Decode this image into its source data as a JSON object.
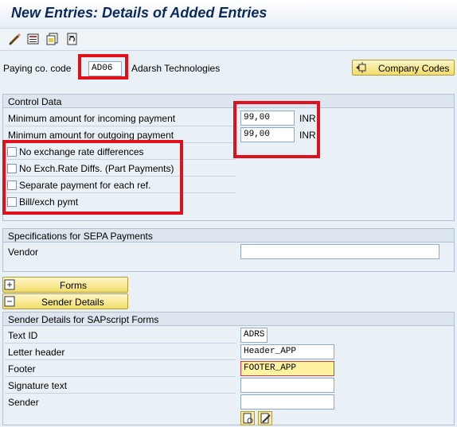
{
  "window": {
    "title": "New Entries: Details of Added Entries"
  },
  "toolbar": {
    "icons": [
      "pencil-edit-icon",
      "save-variant-icon",
      "copy-document-icon",
      "refresh-document-icon"
    ]
  },
  "company": {
    "label": "Paying co. code",
    "code": "AD06",
    "name": "Adarsh Technologies",
    "button_label": "Company Codes"
  },
  "control_data": {
    "title": "Control Data",
    "incoming_label": "Minimum amount for incoming payment",
    "incoming_value": "99,00",
    "incoming_currency": "INR",
    "outgoing_label": "Minimum amount for outgoing payment",
    "outgoing_value": "99,00",
    "outgoing_currency": "INR",
    "checkboxes": [
      {
        "label": "No exchange rate differences",
        "checked": false
      },
      {
        "label": "No Exch.Rate Diffs. (Part Payments)",
        "checked": false
      },
      {
        "label": "Separate payment for each ref.",
        "checked": false
      },
      {
        "label": "Bill/exch pymt",
        "checked": false
      }
    ]
  },
  "sepa": {
    "title": "Specifications for SEPA Payments",
    "vendor_label": "Vendor",
    "vendor_value": ""
  },
  "buttons": {
    "forms": "Forms",
    "sender_details": "Sender Details"
  },
  "sapscript": {
    "title": "Sender Details for SAPscript Forms",
    "fields": [
      {
        "label": "Text ID",
        "value": "ADRS"
      },
      {
        "label": "Letter header",
        "value": "Header_APP"
      },
      {
        "label": "Footer",
        "value": "FOOTER_APP"
      },
      {
        "label": "Signature text",
        "value": ""
      },
      {
        "label": "Sender",
        "value": ""
      }
    ]
  },
  "colors": {
    "highlight": "#e0101c",
    "button": "#f2dd6a",
    "title": "#0b2a5a"
  }
}
